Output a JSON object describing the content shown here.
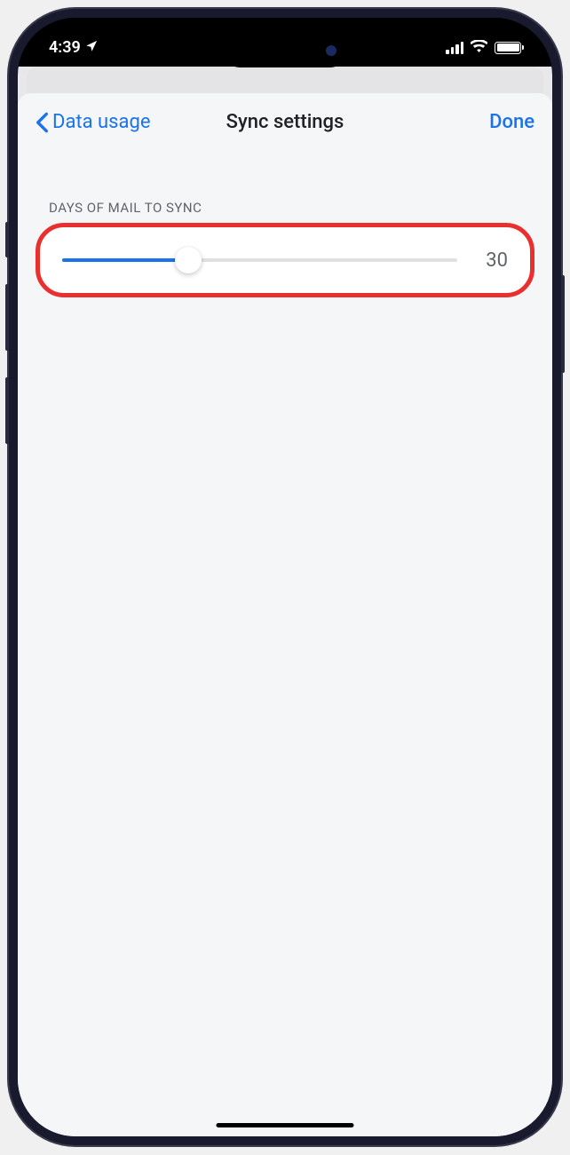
{
  "status": {
    "time": "4:39"
  },
  "nav": {
    "back_label": "Data usage",
    "title": "Sync settings",
    "done_label": "Done"
  },
  "section": {
    "header": "DAYS OF MAIL TO SYNC"
  },
  "slider": {
    "value": "30",
    "percent": 32
  }
}
